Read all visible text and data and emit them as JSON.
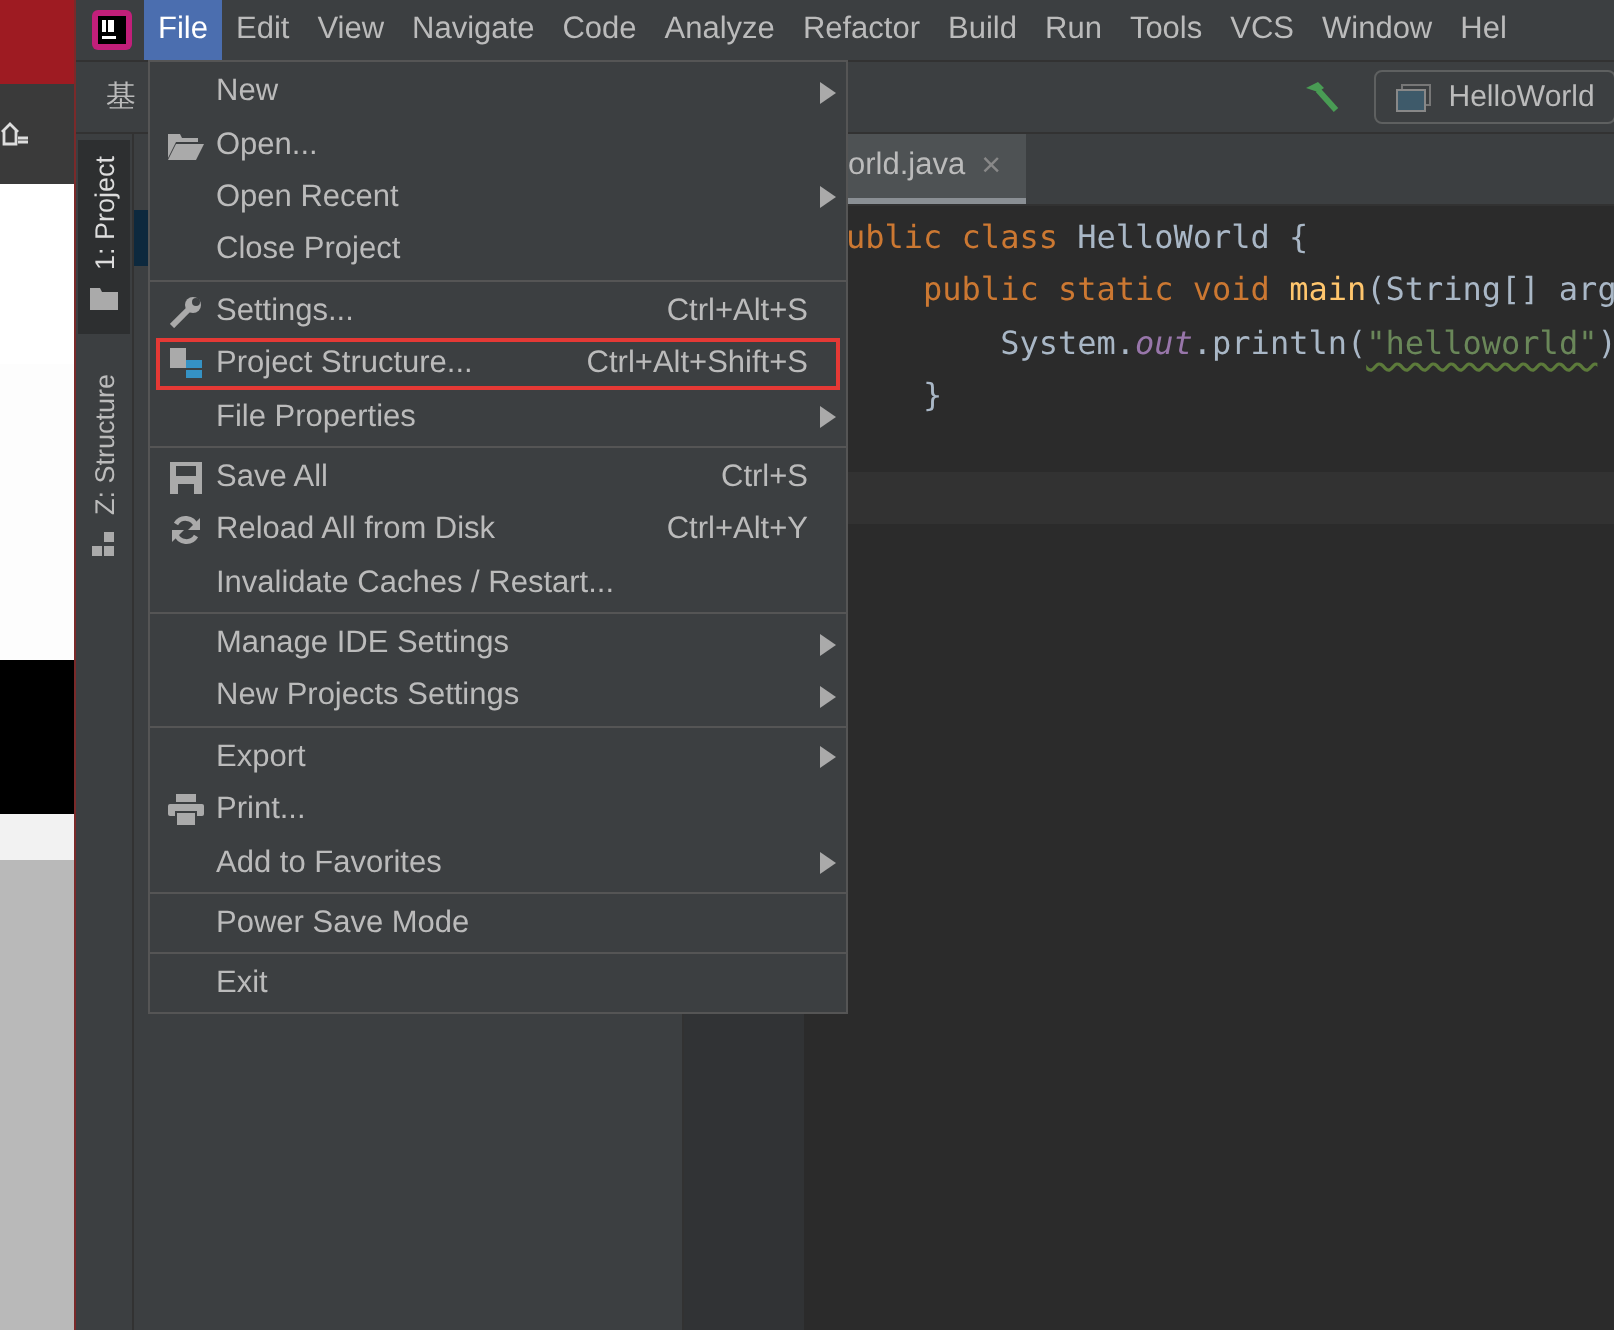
{
  "menu_bar": [
    {
      "label": "File",
      "selected": true
    },
    {
      "label": "Edit",
      "selected": false
    },
    {
      "label": "View",
      "selected": false
    },
    {
      "label": "Navigate",
      "selected": false
    },
    {
      "label": "Code",
      "selected": false
    },
    {
      "label": "Analyze",
      "selected": false
    },
    {
      "label": "Refactor",
      "selected": false
    },
    {
      "label": "Build",
      "selected": false
    },
    {
      "label": "Run",
      "selected": false
    },
    {
      "label": "Tools",
      "selected": false
    },
    {
      "label": "VCS",
      "selected": false
    },
    {
      "label": "Window",
      "selected": false
    },
    {
      "label": "Hel",
      "selected": false
    }
  ],
  "toolbar": {
    "project_label": "基",
    "run_config": "HelloWorld"
  },
  "tool_windows": [
    {
      "label": "1: Project",
      "selected": true
    },
    {
      "label": "Z: Structure",
      "selected": false
    }
  ],
  "editor": {
    "tab": {
      "label": "orld.java",
      "close": "×"
    },
    "lines": [
      [
        {
          "kind": "keyword",
          "text": "ublic class "
        },
        {
          "kind": "plain",
          "text": "HelloWorld {"
        }
      ],
      [
        {
          "kind": "keyword",
          "text": "    public static void "
        },
        {
          "kind": "method",
          "text": "main"
        },
        {
          "kind": "plain",
          "text": "(String[] arg"
        }
      ],
      [
        {
          "kind": "plain",
          "text": "        System."
        },
        {
          "kind": "field",
          "text": "out"
        },
        {
          "kind": "plain",
          "text": ".println("
        },
        {
          "kind": "string",
          "text": "\"helloworld\""
        },
        {
          "kind": "plain",
          "text": ")"
        }
      ],
      [
        {
          "kind": "plain",
          "text": "    }"
        }
      ]
    ]
  },
  "file_menu": {
    "items": [
      {
        "kind": "item",
        "label": "New",
        "submenu": true,
        "highlighted": false
      },
      {
        "kind": "item",
        "label": "Open...",
        "submenu": false,
        "highlighted": false
      },
      {
        "kind": "item",
        "label": "Open Recent",
        "submenu": true,
        "highlighted": false
      },
      {
        "kind": "item",
        "label": "Close Project",
        "submenu": false,
        "highlighted": false
      },
      {
        "kind": "separator"
      },
      {
        "kind": "item",
        "label": "Settings...",
        "shortcut": "Ctrl+Alt+S",
        "submenu": false,
        "highlighted": false
      },
      {
        "kind": "item",
        "label": "Project Structure...",
        "shortcut": "Ctrl+Alt+Shift+S",
        "submenu": false,
        "highlighted": true
      },
      {
        "kind": "item",
        "label": "File Properties",
        "submenu": true,
        "highlighted": false
      },
      {
        "kind": "separator"
      },
      {
        "kind": "item",
        "label": "Save All",
        "shortcut": "Ctrl+S",
        "submenu": false,
        "highlighted": false
      },
      {
        "kind": "item",
        "label": "Reload All from Disk",
        "shortcut": "Ctrl+Alt+Y",
        "submenu": false,
        "highlighted": false
      },
      {
        "kind": "item",
        "label": "Invalidate Caches / Restart...",
        "submenu": false,
        "highlighted": false
      },
      {
        "kind": "separator"
      },
      {
        "kind": "item",
        "label": "Manage IDE Settings",
        "submenu": true,
        "highlighted": false
      },
      {
        "kind": "item",
        "label": "New Projects Settings",
        "submenu": true,
        "highlighted": false
      },
      {
        "kind": "separator"
      },
      {
        "kind": "item",
        "label": "Export",
        "submenu": true,
        "highlighted": false
      },
      {
        "kind": "item",
        "label": "Print...",
        "submenu": false,
        "highlighted": false
      },
      {
        "kind": "item",
        "label": "Add to Favorites",
        "submenu": true,
        "highlighted": false
      },
      {
        "kind": "separator"
      },
      {
        "kind": "item",
        "label": "Power Save Mode",
        "submenu": false,
        "highlighted": false
      },
      {
        "kind": "separator"
      },
      {
        "kind": "item",
        "label": "Exit",
        "submenu": false,
        "highlighted": false
      }
    ]
  }
}
